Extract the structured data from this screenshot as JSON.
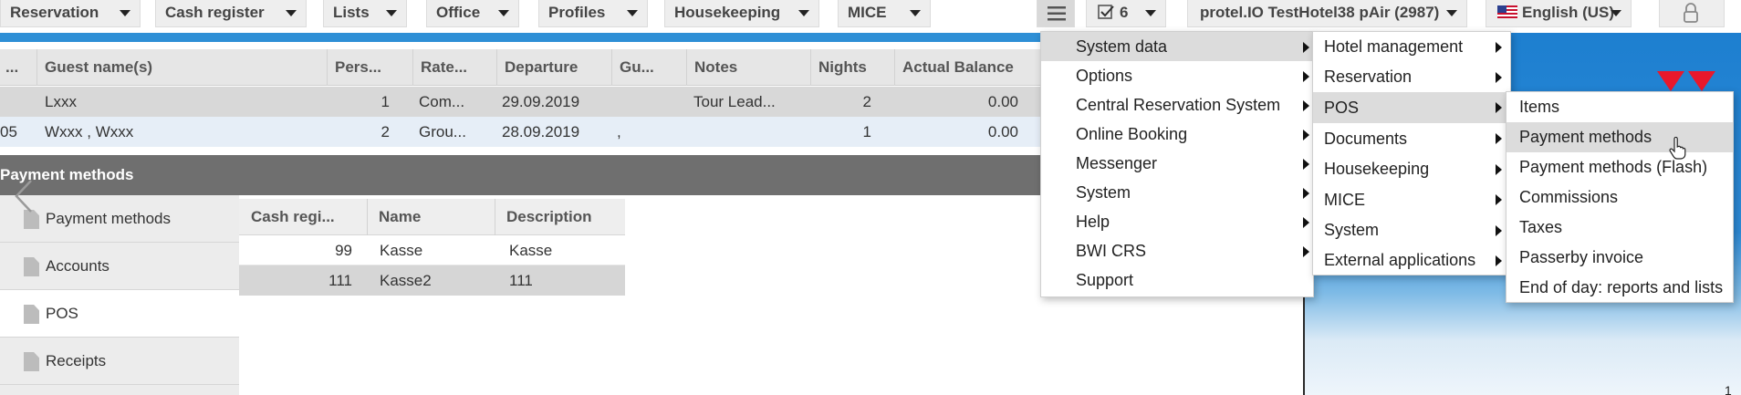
{
  "topbar": {
    "menus": [
      "Reservation",
      "Cash register",
      "Lists",
      "Office",
      "Profiles",
      "Housekeeping",
      "MICE"
    ],
    "tasks_count": "6",
    "hotel": "protel.IO TestHotel38 pAir (2987)",
    "language": "English (US)"
  },
  "grid": {
    "columns": [
      "...",
      "Guest name(s)",
      "Pers...",
      "Rate...",
      "Departure",
      "Gu...",
      "Notes",
      "Nights",
      "Actual Balance"
    ],
    "rows": [
      {
        "id": "",
        "guest": "Lxxx",
        "persons": "1",
        "rate": "Com...",
        "departure": "29.09.2019",
        "gu": "",
        "notes": "Tour Lead...",
        "nights": "2",
        "balance": "0.00"
      },
      {
        "id": "05",
        "guest": "Wxxx , Wxxx",
        "persons": "2",
        "rate": "Grou...",
        "departure": "28.09.2019",
        "gu": ",",
        "notes": "",
        "nights": "1",
        "balance": "0.00"
      }
    ]
  },
  "panel": {
    "title": "Payment methods",
    "sidebar": [
      "Payment methods",
      "Accounts",
      "POS",
      "Receipts"
    ],
    "columns": [
      "Cash regi...",
      "Name",
      "Description"
    ],
    "rows": [
      {
        "register": "99",
        "name": "Kasse",
        "description": "Kasse"
      },
      {
        "register": "111",
        "name": "Kasse2",
        "description": "111"
      }
    ]
  },
  "menu_main": [
    "System data",
    "Options",
    "Central Reservation System",
    "Online Booking",
    "Messenger",
    "System",
    "Help",
    "BWI CRS",
    "Support"
  ],
  "menu_system_data": [
    "Hotel management",
    "Reservation",
    "POS",
    "Documents",
    "Housekeeping",
    "MICE",
    "System",
    "External applications"
  ],
  "menu_pos": [
    "Items",
    "Payment methods",
    "Payment methods (Flash)",
    "Commissions",
    "Taxes",
    "Passerby invoice",
    "End of day: reports and lists"
  ],
  "page_number": "1",
  "colors": {
    "accent_blue": "#2e8fd6",
    "panel_header": "#6f6f6f",
    "alert_red": "#e8182c"
  }
}
